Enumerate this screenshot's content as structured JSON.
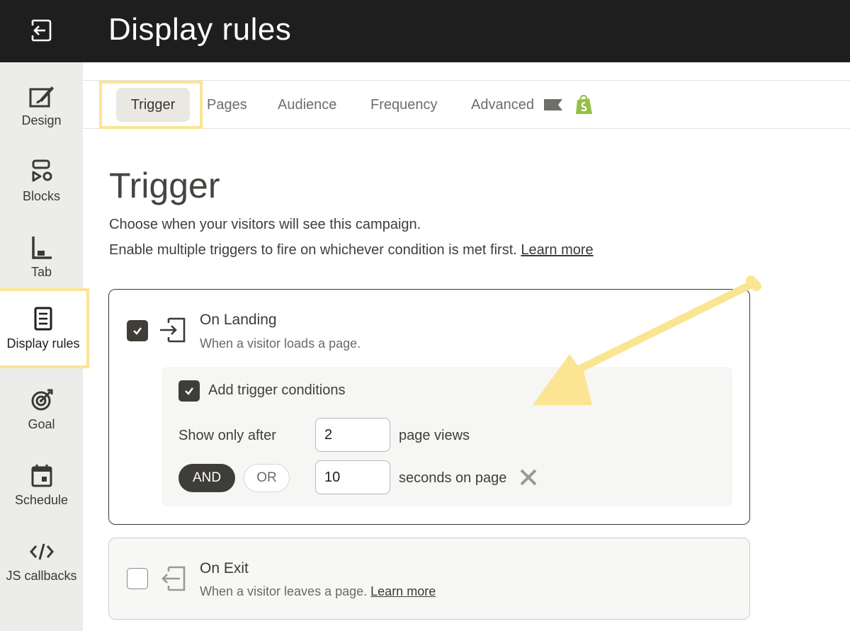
{
  "header": {
    "title": "Display rules",
    "exit_icon": "exit-icon"
  },
  "sidebar": {
    "items": [
      {
        "label": "Design",
        "icon": "design-brush-icon"
      },
      {
        "label": "Blocks",
        "icon": "blocks-icon"
      },
      {
        "label": "Tab",
        "icon": "tab-icon"
      },
      {
        "label": "Display rules",
        "icon": "document-list-icon",
        "active": true
      },
      {
        "label": "Goal",
        "icon": "target-icon"
      },
      {
        "label": "Schedule",
        "icon": "calendar-icon"
      },
      {
        "label": "JS callbacks",
        "icon": "code-icon"
      }
    ]
  },
  "tabs": [
    {
      "label": "Trigger",
      "active": true
    },
    {
      "label": "Pages"
    },
    {
      "label": "Audience"
    },
    {
      "label": "Frequency"
    },
    {
      "label": "Advanced",
      "icons": [
        "flag-icon",
        "shopify-bag-icon"
      ]
    }
  ],
  "main": {
    "title": "Trigger",
    "desc_line1": "Choose when your visitors will see this campaign.",
    "desc_line2": "Enable multiple triggers to fire on whichever condition is met first.",
    "learn_more": "Learn more"
  },
  "triggers": {
    "landing": {
      "title": "On Landing",
      "subtitle": "When a visitor loads a page.",
      "checked": true,
      "conditions_label": "Add trigger conditions",
      "conditions_checked": true,
      "show_after_label": "Show only after",
      "page_views_value": "2",
      "page_views_label": "page views",
      "and_label": "AND",
      "or_label": "OR",
      "seconds_value": "10",
      "seconds_label": "seconds on page"
    },
    "exit": {
      "title": "On Exit",
      "subtitle": "When a visitor leaves a page.",
      "learn_more": "Learn more",
      "checked": false
    }
  },
  "colors": {
    "highlight": "#fbe593",
    "dark": "#3e3d38",
    "header_bg": "#1e1e1e",
    "sidebar_bg": "#ececea"
  }
}
